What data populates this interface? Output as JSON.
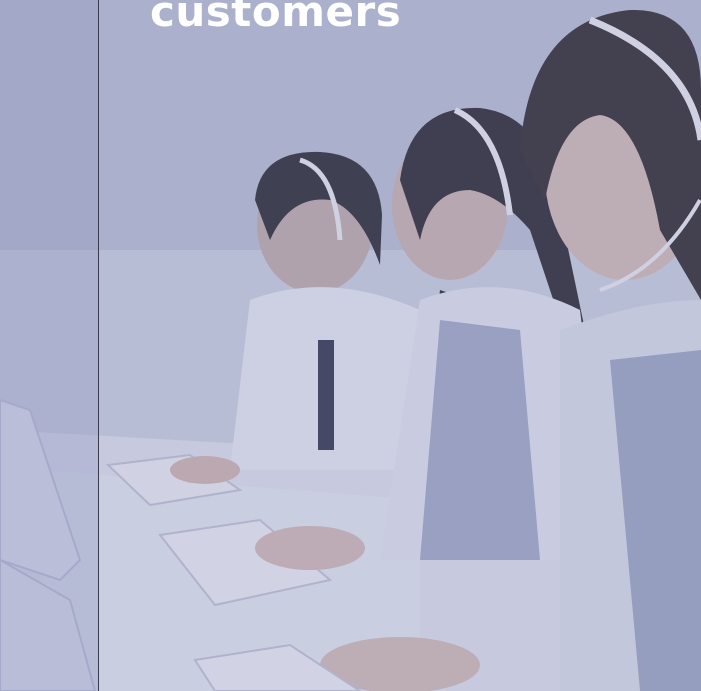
{
  "hero": {
    "headline": "customers",
    "image_icon": "call-center-photo",
    "overlay_color": "#7076aa"
  }
}
